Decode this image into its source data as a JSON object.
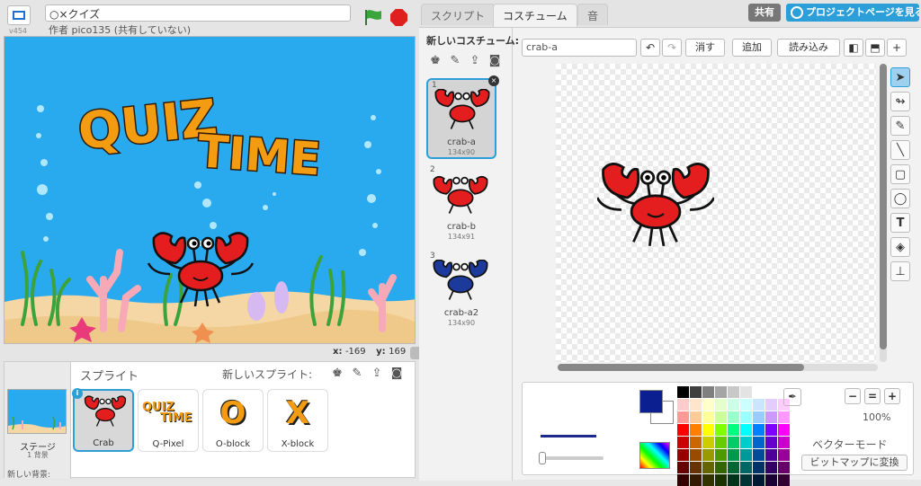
{
  "header": {
    "version": "v454",
    "project_title": "○×クイズ",
    "author": "作者 pico135 (共有していない)"
  },
  "stage": {
    "title_line1": "QUIZ",
    "title_line2": "TIME",
    "coords_x_label": "x:",
    "coords_x": "-169",
    "coords_y_label": "y:",
    "coords_y": "169"
  },
  "sprite_pane": {
    "stage_label": "ステージ",
    "stage_count": "1 背景",
    "new_backdrop": "新しい背景:",
    "sprites_header": "スプライト",
    "new_sprite": "新しいスプライト:",
    "sprites": [
      {
        "name": "Crab",
        "selected": true
      },
      {
        "name": "Q-Pixel",
        "selected": false
      },
      {
        "name": "O-block",
        "selected": false
      },
      {
        "name": "X-block",
        "selected": false
      }
    ],
    "thumb_text": {
      "qp1": "QUIZ",
      "qp2": "TIME",
      "o": "O",
      "x": "X"
    }
  },
  "tabs": [
    {
      "label": "スクリプト",
      "active": false
    },
    {
      "label": "コスチューム",
      "active": true
    },
    {
      "label": "音",
      "active": false
    }
  ],
  "top_right": {
    "share": "共有",
    "project_page": "プロジェクトページを見る"
  },
  "costume_list": {
    "new_costume": "新しいコスチューム:",
    "costumes": [
      {
        "num": "1",
        "name": "crab-a",
        "size": "134x90",
        "color": "#e41e1e"
      },
      {
        "num": "2",
        "name": "crab-b",
        "size": "134x91",
        "color": "#e41e1e"
      },
      {
        "num": "3",
        "name": "crab-a2",
        "size": "134x90",
        "color": "#1c3a9c"
      }
    ]
  },
  "editor": {
    "costume_name": "crab-a",
    "clear": "消す",
    "add": "追加",
    "import": "読み込み"
  },
  "paint": {
    "zoom": "100%",
    "vector_mode": "ベクターモード",
    "convert_bitmap": "ビットマップに変換",
    "primary_color": "#0c1f91",
    "palette": [
      "#000000",
      "#3f3f3f",
      "#7f7f7f",
      "#a5a5a5",
      "#c8c8c8",
      "#e3e3e3",
      "#ffffff",
      "#ffffff",
      "#ffffff",
      "#ffcccc",
      "#ffe5cc",
      "#ffffcc",
      "#e5ffcc",
      "#ccffe5",
      "#ccffff",
      "#cce5ff",
      "#e5ccff",
      "#ffccff",
      "#ff9999",
      "#ffcc99",
      "#ffff99",
      "#ccff99",
      "#99ffcc",
      "#99ffff",
      "#99ccff",
      "#cc99ff",
      "#ff99ff",
      "#ff0000",
      "#ff8000",
      "#ffff00",
      "#80ff00",
      "#00ff80",
      "#00ffff",
      "#0080ff",
      "#8000ff",
      "#ff00ff",
      "#cc0000",
      "#cc6600",
      "#cccc00",
      "#66cc00",
      "#00cc66",
      "#00cccc",
      "#0066cc",
      "#6600cc",
      "#cc00cc",
      "#990000",
      "#994c00",
      "#999900",
      "#4c9900",
      "#00994c",
      "#009999",
      "#004c99",
      "#4c0099",
      "#990099",
      "#660000",
      "#663300",
      "#666600",
      "#336600",
      "#006633",
      "#006666",
      "#003366",
      "#330066",
      "#660066",
      "#330000",
      "#331a00",
      "#333300",
      "#1a3300",
      "#00331a",
      "#003333",
      "#001a33",
      "#1a0033",
      "#330033"
    ]
  }
}
